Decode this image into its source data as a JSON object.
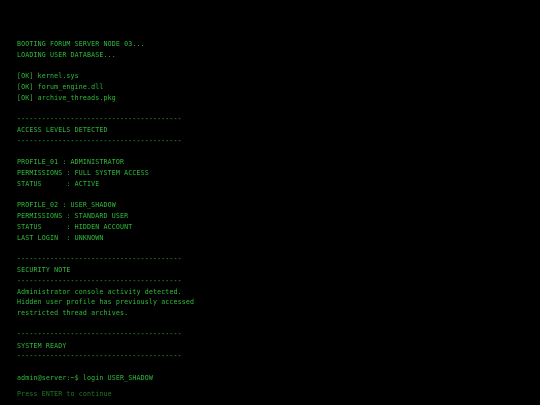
{
  "terminal": {
    "boot": [
      "BOOTING FORUM SERVER NODE 03...",
      "LOADING USER DATABASE..."
    ],
    "modules": [
      "[OK] kernel.sys",
      "[OK] forum_engine.dll",
      "[OK] archive_threads.pkg"
    ],
    "divider": "----------------------------------------",
    "access_header": "ACCESS LEVELS DETECTED",
    "profile1": {
      "line1": "PROFILE_01 : ADMINISTRATOR",
      "line2": "PERMISSIONS : FULL SYSTEM ACCESS",
      "line3": "STATUS      : ACTIVE"
    },
    "profile2": {
      "line1": "PROFILE_02 : USER_SHADOW",
      "line2": "PERMISSIONS : STANDARD USER",
      "line3": "STATUS      : HIDDEN ACCOUNT",
      "line4": "LAST LOGIN  : UNKNOWN"
    },
    "security_header": "SECURITY NOTE",
    "security_lines": [
      "Administrator console activity detected.",
      "Hidden user profile has previously accessed",
      "restricted thread archives."
    ],
    "ready_header": "SYSTEM READY",
    "prompt": "admin@server:~$ login USER_SHADOW",
    "hint": "Press ENTER to continue"
  },
  "colors": {
    "background": "#000000",
    "text": "#2fbf3a",
    "hint": "#1f7a27"
  }
}
